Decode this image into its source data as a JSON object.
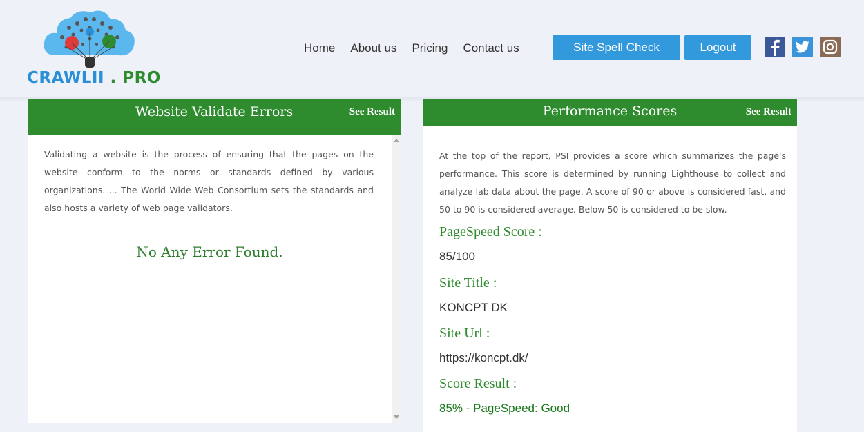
{
  "header": {
    "logo": {
      "brand": "CRAWLII",
      "separator": " . ",
      "suffix": "PRO"
    },
    "nav": [
      "Home",
      "About us",
      "Pricing",
      "Contact us"
    ],
    "spell_check_label": "Site Spell Check",
    "logout_label": "Logout",
    "social": {
      "facebook": "facebook-icon",
      "twitter": "twitter-icon",
      "instagram": "instagram-icon"
    }
  },
  "validate_panel": {
    "title": "Website Validate Errors",
    "see_result": "See Result",
    "description": "Validating a website is the process of ensuring that the pages on the website conform to the norms or standards defined by various organizations. ... The World Wide Web Consortium sets the standards and also hosts a variety of web page validators.",
    "result": "No Any Error Found."
  },
  "performance_panel": {
    "title": "Performance Scores",
    "see_result": "See Result",
    "description": "At the top of the report, PSI provides a score which summarizes the page's performance. This score is determined by running Lighthouse to collect and analyze lab data about the page. A score of 90 or above is considered fast, and 50 to 90 is considered average. Below 50 is considered to be slow.",
    "pagespeed_label": "PageSpeed Score :",
    "pagespeed_value": "85/100",
    "site_title_label": "Site Title :",
    "site_title_value": "KONCPT DK",
    "site_url_label": "Site Url :",
    "site_url_value": "https://koncpt.dk/",
    "score_result_label": "Score Result :",
    "score_result_value": "85% - PageSpeed: Good"
  },
  "colors": {
    "brand_blue": "#2a8fd6",
    "brand_green": "#2e8b2e",
    "button_blue": "#3399dd"
  }
}
